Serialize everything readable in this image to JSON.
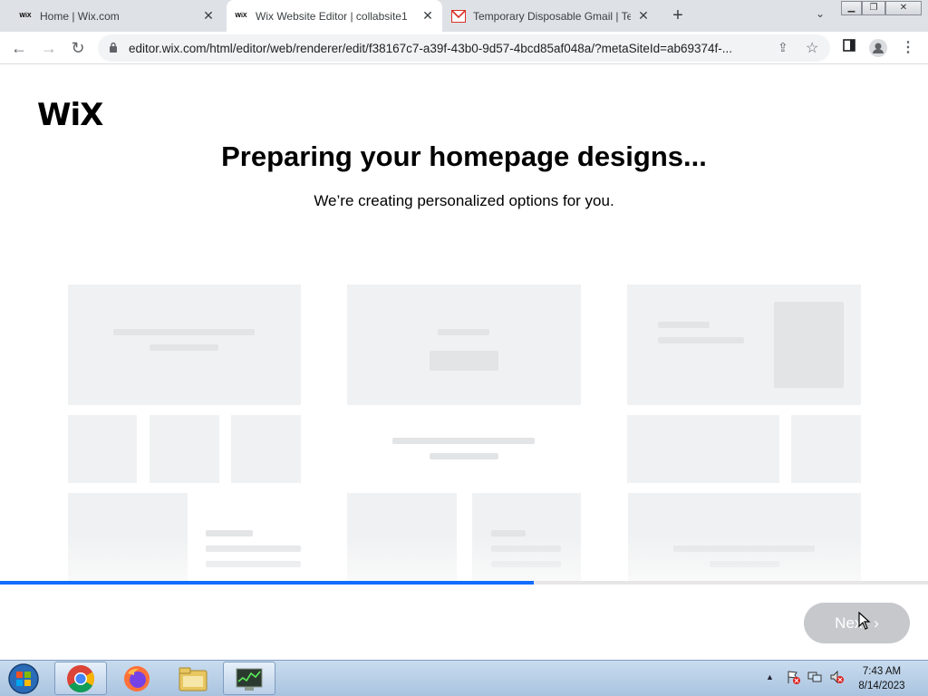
{
  "browser": {
    "tabs": [
      {
        "favicon": "WiX",
        "title": "Home | Wix.com",
        "active": false
      },
      {
        "favicon": "WiX",
        "title": "Wix Website Editor | collabsite1",
        "active": true
      },
      {
        "favicon": "gmail-icon",
        "title": "Temporary Disposable Gmail | Te",
        "active": false
      }
    ],
    "url": "editor.wix.com/html/editor/web/renderer/edit/f38167c7-a39f-43b0-9d57-4bcd85af048a/?metaSiteId=ab69374f-..."
  },
  "page": {
    "logo": "WiX",
    "heading": "Preparing your homepage designs...",
    "subheading": "We’re creating personalized options for you.",
    "progress_percent": 57.5,
    "next_label": "Next",
    "next_chevron": "›"
  },
  "taskbar": {
    "apps": [
      "start-orb-icon",
      "chrome-icon",
      "firefox-icon",
      "file-explorer-icon",
      "task-manager-icon"
    ],
    "clock_time": "7:43 AM",
    "clock_date": "8/14/2023"
  },
  "colors": {
    "accent": "#116dff",
    "skeleton": "#f0f1f2",
    "skeleton_dark": "#e3e4e6",
    "button_disabled": "#c6c8cc"
  }
}
